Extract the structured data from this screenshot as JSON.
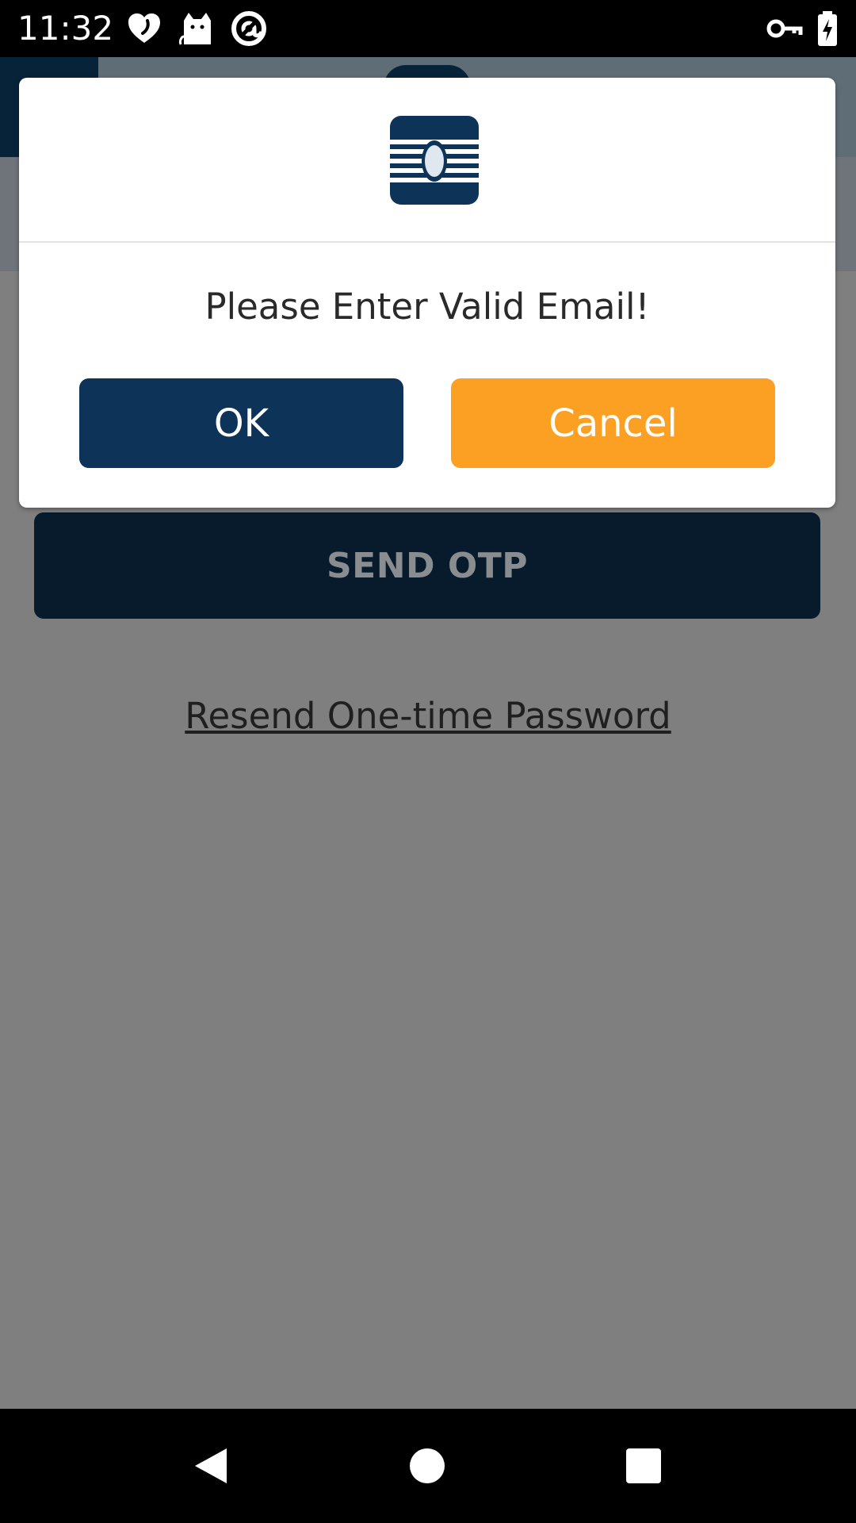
{
  "status_bar": {
    "time": "11:32",
    "left_icons": [
      "heart-icon",
      "cat-icon",
      "at-sign-icon"
    ],
    "right_icons": [
      "key-icon",
      "battery-charging-icon"
    ]
  },
  "background": {
    "send_otp_label": "SEND OTP",
    "resend_link": "Resend One-time Password"
  },
  "dialog": {
    "logo": "app-logo-icon",
    "message": "Please Enter Valid Email!",
    "ok_label": "OK",
    "cancel_label": "Cancel"
  },
  "nav_bar": {
    "icons": [
      "back-icon",
      "home-icon",
      "recents-icon"
    ]
  },
  "colors": {
    "primary": "#0d3359",
    "accent": "#fba022",
    "scrim": "#7f7f7f"
  }
}
